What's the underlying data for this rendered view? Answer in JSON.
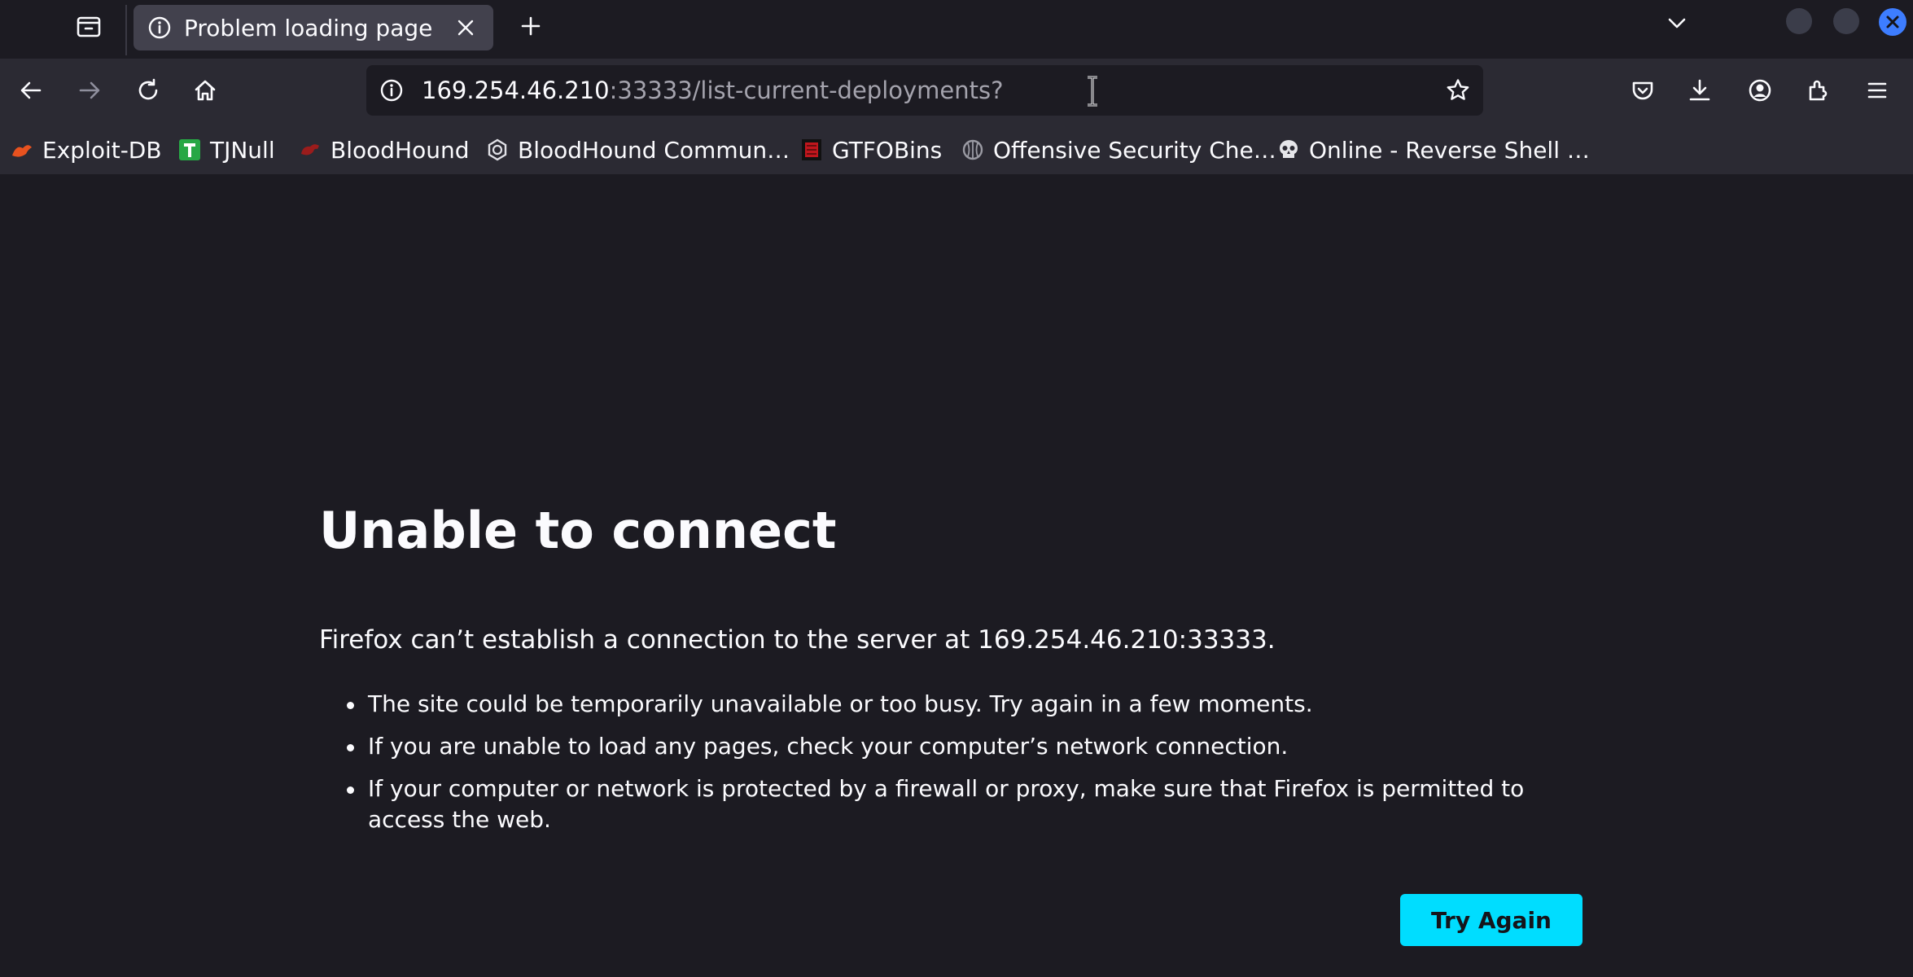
{
  "window": {
    "tabs": [
      {
        "title": "Problem loading page",
        "icon": "info-icon",
        "active": true
      }
    ]
  },
  "navbar": {
    "url_host": "169.254.46.210",
    "url_rest": ":33333/list-current-deployments?"
  },
  "bookmarks": [
    {
      "label": "Exploit-DB",
      "icon": "exploit-db-icon"
    },
    {
      "label": "TJNull",
      "icon": "tjnull-icon"
    },
    {
      "label": "BloodHound",
      "icon": "bloodhound-icon"
    },
    {
      "label": "BloodHound Commun…",
      "icon": "bloodhound-community-icon"
    },
    {
      "label": "GTFOBins",
      "icon": "gtfobins-icon"
    },
    {
      "label": "Offensive Security Che…",
      "icon": "offsec-icon"
    },
    {
      "label": "Online - Reverse Shell …",
      "icon": "skull-icon"
    }
  ],
  "error": {
    "title": "Unable to connect",
    "description": "Firefox can’t establish a connection to the server at 169.254.46.210:33333.",
    "bullets": [
      "The site could be temporarily unavailable or too busy. Try again in a few moments.",
      "If you are unable to load any pages, check your computer’s network connection.",
      "If your computer or network is protected by a firewall or proxy, make sure that Firefox is permitted to access the web."
    ],
    "button": "Try Again"
  },
  "colors": {
    "page_bg": "#1c1b22",
    "toolbar_bg": "#2b2a33",
    "accent": "#00ddff",
    "window_close": "#3d7dff"
  }
}
